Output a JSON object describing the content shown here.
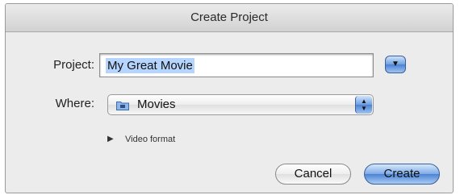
{
  "dialog": {
    "title": "Create Project"
  },
  "project": {
    "label": "Project:",
    "value": "My Great Movie"
  },
  "where": {
    "label": "Where:",
    "value": "Movies",
    "icon": "folder-icon"
  },
  "video_format": {
    "label": "Video format",
    "expanded": false
  },
  "buttons": {
    "cancel": "Cancel",
    "create": "Create"
  },
  "colors": {
    "accent": "#4b82d2",
    "selection": "#b5d5ff",
    "background": "#ececec"
  }
}
